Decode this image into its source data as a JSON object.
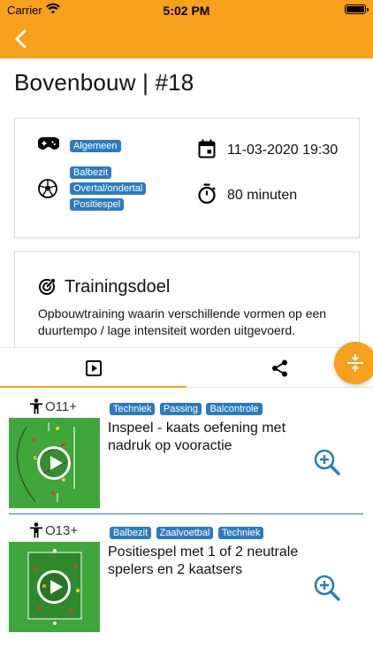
{
  "status": {
    "carrier": "Carrier",
    "time": "5:02 PM"
  },
  "colors": {
    "accent": "#f7a01b",
    "tag": "#2b7bc0",
    "divider": "#2b7bc0"
  },
  "header": {
    "back_icon": "chevron-left-icon",
    "title": "Bovenbouw | #18"
  },
  "info": {
    "category_icon": "gamepad-icon",
    "category_tags": [
      "Algemeen"
    ],
    "ball_icon": "football-icon",
    "theme_tags": [
      "Balbezit",
      "Overtal/ondertal",
      "Positiespel"
    ],
    "date_icon": "calendar-icon",
    "datetime": "11-03-2020 19:30",
    "duration_icon": "stopwatch-icon",
    "duration": "80 minuten"
  },
  "goal": {
    "icon": "target-icon",
    "title": "Trainingsdoel",
    "description": "Opbouwtraining waarin verschillende vormen op een duurtempo / lage intensiteit worden uitgevoerd."
  },
  "tabs": [
    {
      "icon": "video-play-icon",
      "active": true
    },
    {
      "icon": "share-icon",
      "active": false
    }
  ],
  "fab": {
    "icon": "collapse-icon"
  },
  "exercises": [
    {
      "age": "O11+",
      "tags": [
        "Techniek",
        "Passing",
        "Balcontrole"
      ],
      "title": "Inspeel - kaats oefening met nadruk op vooractie"
    },
    {
      "age": "O13+",
      "tags": [
        "Balbezit",
        "Zaalvoetbal",
        "Techniek"
      ],
      "title": "Positiespel met 1 of 2 neutrale spelers en 2 kaatsers"
    }
  ]
}
